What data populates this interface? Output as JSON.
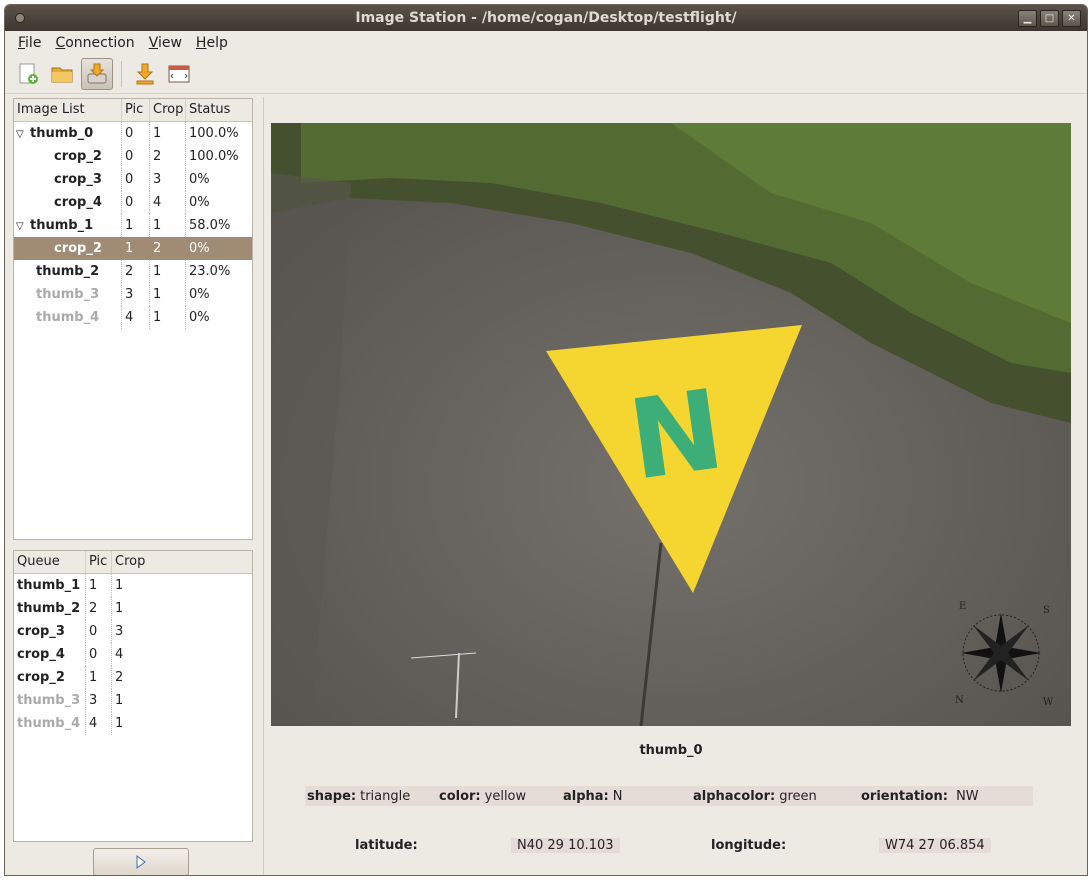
{
  "window": {
    "title": "Image Station - /home/cogan/Desktop/testflight/"
  },
  "menu": [
    {
      "label": "File",
      "underline": "F",
      "rest": "ile"
    },
    {
      "label": "Connection",
      "underline": "C",
      "rest": "onnection"
    },
    {
      "label": "View",
      "underline": "V",
      "rest": "iew"
    },
    {
      "label": "Help",
      "underline": "H",
      "rest": "elp"
    }
  ],
  "image_list": {
    "headers": [
      "Image List",
      "Pic",
      "Crop",
      "Status"
    ],
    "rows": [
      {
        "name": "thumb_0",
        "pic": "0",
        "crop": "1",
        "status": "100.0%"
      },
      {
        "name": "crop_2",
        "pic": "0",
        "crop": "2",
        "status": "100.0%"
      },
      {
        "name": "crop_3",
        "pic": "0",
        "crop": "3",
        "status": "0%"
      },
      {
        "name": "crop_4",
        "pic": "0",
        "crop": "4",
        "status": "0%"
      },
      {
        "name": "thumb_1",
        "pic": "1",
        "crop": "1",
        "status": "58.0%"
      },
      {
        "name": "crop_2",
        "pic": "1",
        "crop": "2",
        "status": "0%"
      },
      {
        "name": "thumb_2",
        "pic": "2",
        "crop": "1",
        "status": "23.0%"
      },
      {
        "name": "thumb_3",
        "pic": "3",
        "crop": "1",
        "status": "0%"
      },
      {
        "name": "thumb_4",
        "pic": "4",
        "crop": "1",
        "status": "0%"
      }
    ]
  },
  "queue": {
    "headers": [
      "Queue",
      "Pic",
      "Crop"
    ],
    "rows": [
      {
        "name": "thumb_1",
        "pic": "1",
        "crop": "1"
      },
      {
        "name": "thumb_2",
        "pic": "2",
        "crop": "1"
      },
      {
        "name": "crop_3",
        "pic": "0",
        "crop": "3"
      },
      {
        "name": "crop_4",
        "pic": "0",
        "crop": "4"
      },
      {
        "name": "crop_2",
        "pic": "1",
        "crop": "2"
      },
      {
        "name": "thumb_3",
        "pic": "3",
        "crop": "1"
      },
      {
        "name": "thumb_4",
        "pic": "4",
        "crop": "1"
      }
    ]
  },
  "viewer": {
    "caption": "thumb_0",
    "target_letter": "N",
    "compass_letters": [
      "E",
      "S",
      "W",
      "N"
    ],
    "shape_label": "shape:",
    "shape": "triangle",
    "color_label": "color:",
    "color": "yellow",
    "alpha_label": "alpha:",
    "alpha": "N",
    "alphacolor_label": "alphacolor:",
    "alphacolor": "green",
    "orientation_label": "orientation:",
    "orientation": "NW",
    "latitude_label": "latitude:",
    "latitude": "N40 29 10.103",
    "longitude_label": "longitude:",
    "longitude": "W74 27 06.854"
  },
  "colors": {
    "selection": "#a08c74",
    "target": "#f5d631",
    "letter": "#3dae78"
  }
}
